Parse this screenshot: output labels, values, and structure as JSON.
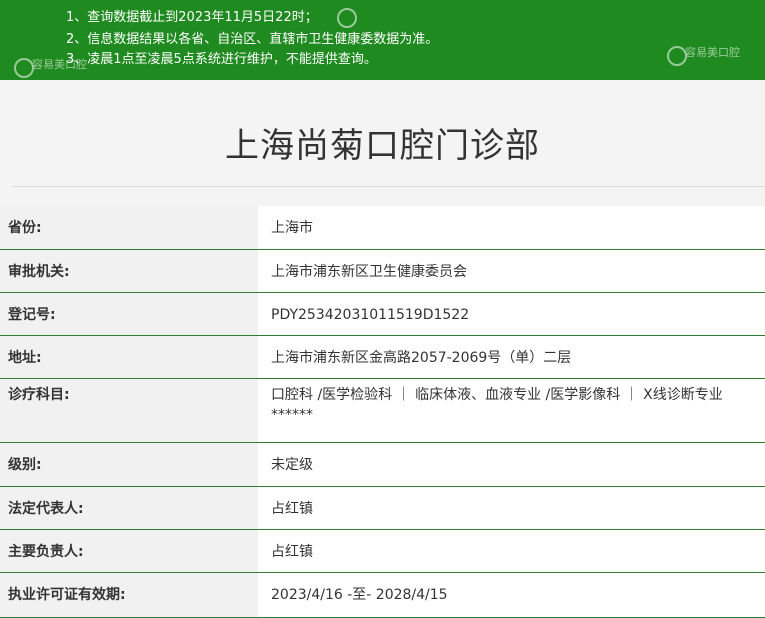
{
  "notice": {
    "lines": [
      "1、查询数据截止到2023年11月5日22时；",
      "2、信息数据结果以各省、自治区、直辖市卫生健康委数据为准。",
      "3、凌晨1点至凌晨5点系统进行维护，不能提供查询。"
    ],
    "watermark": "容易美口腔"
  },
  "title": "上海尚菊口腔门诊部",
  "rows": [
    {
      "label": "省份:",
      "value": "上海市"
    },
    {
      "label": "审批机关:",
      "value": "上海市浦东新区卫生健康委员会"
    },
    {
      "label": "登记号:",
      "value": "PDY25342031011519D1522"
    },
    {
      "label": "地址:",
      "value": "上海市浦东新区金高路2057-2069号（单）二层"
    },
    {
      "label": "诊疗科目:",
      "value": "口腔科 /医学检验科 ｜ 临床体液、血液专业 /医学影像科 ｜ X线诊断专业 ******"
    },
    {
      "label": "级别:",
      "value": "未定级"
    },
    {
      "label": "法定代表人:",
      "value": "占红镇"
    },
    {
      "label": "主要负责人:",
      "value": "占红镇"
    },
    {
      "label": "执业许可证有效期:",
      "value": "2023/4/16 -至- 2028/4/15"
    }
  ],
  "colors": {
    "notice_bg": "#1f8a1f",
    "row_border": "#2e7d32"
  }
}
